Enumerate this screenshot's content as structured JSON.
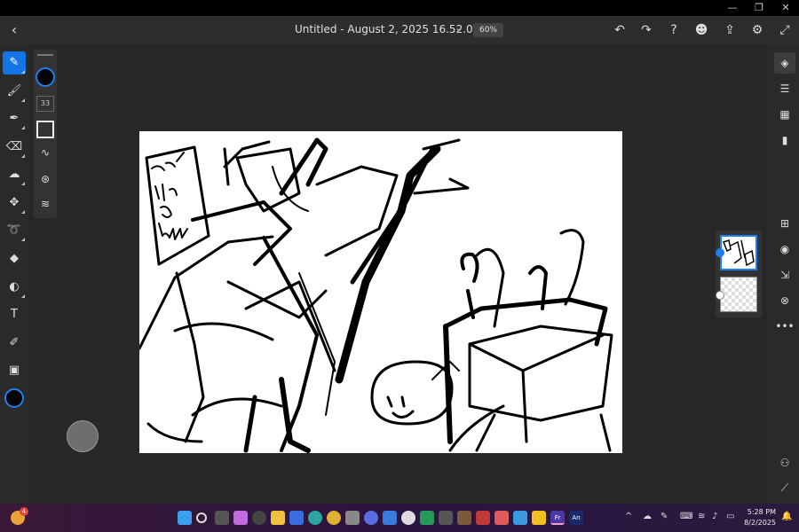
{
  "window": {
    "minimize": "—",
    "restore": "❐",
    "close": "✕"
  },
  "header": {
    "back": "‹",
    "title": "Untitled - August 2, 2025 16.52.05*",
    "chevron": "⌄",
    "zoom": "60%",
    "undo": "↶",
    "redo": "↷",
    "help": "?",
    "people": "☻",
    "share": "⇪",
    "settings": "⚙",
    "fullscreen": "⤢"
  },
  "left_tools": [
    {
      "name": "pixel-brush-tool",
      "glyph": "✎",
      "active": true
    },
    {
      "name": "live-brush-tool",
      "glyph": "🖌",
      "active": false
    },
    {
      "name": "vector-brush-tool",
      "glyph": "✒",
      "active": false
    },
    {
      "name": "eraser-tool",
      "glyph": "⌫",
      "active": false
    },
    {
      "name": "smudge-tool",
      "glyph": "☁",
      "active": false
    },
    {
      "name": "move-tool",
      "glyph": "✥",
      "active": false
    },
    {
      "name": "lasso-tool",
      "glyph": "➰",
      "active": false
    },
    {
      "name": "fill-tool",
      "glyph": "◆",
      "active": false
    },
    {
      "name": "shapes-tool",
      "glyph": "◐",
      "active": false
    },
    {
      "name": "text-tool",
      "glyph": "T",
      "active": false
    },
    {
      "name": "eyedropper-tool",
      "glyph": "✐",
      "active": false
    },
    {
      "name": "image-tool",
      "glyph": "▣",
      "active": false
    }
  ],
  "options": {
    "size": "33",
    "smoothing": "∿",
    "pressure": "⊛",
    "settings": "≋"
  },
  "right_tools": {
    "layers": "◈",
    "properties": "☰",
    "grid": "▦",
    "comments": "▮",
    "add_layer": "⊞",
    "visibility": "◉",
    "import": "⇲",
    "blend": "⊗",
    "more": "•••",
    "adjust": "⚇",
    "ruler": "⟋"
  },
  "taskbar": {
    "time": "5:28 PM",
    "date": "8/2/2025",
    "notification_count": "4",
    "up_arrow": "^",
    "fresco_label": "Fr",
    "animate_label": "An"
  },
  "colors": {
    "accent": "#1473e6",
    "app_bg": "#282828",
    "canvas": "#ffffff"
  }
}
